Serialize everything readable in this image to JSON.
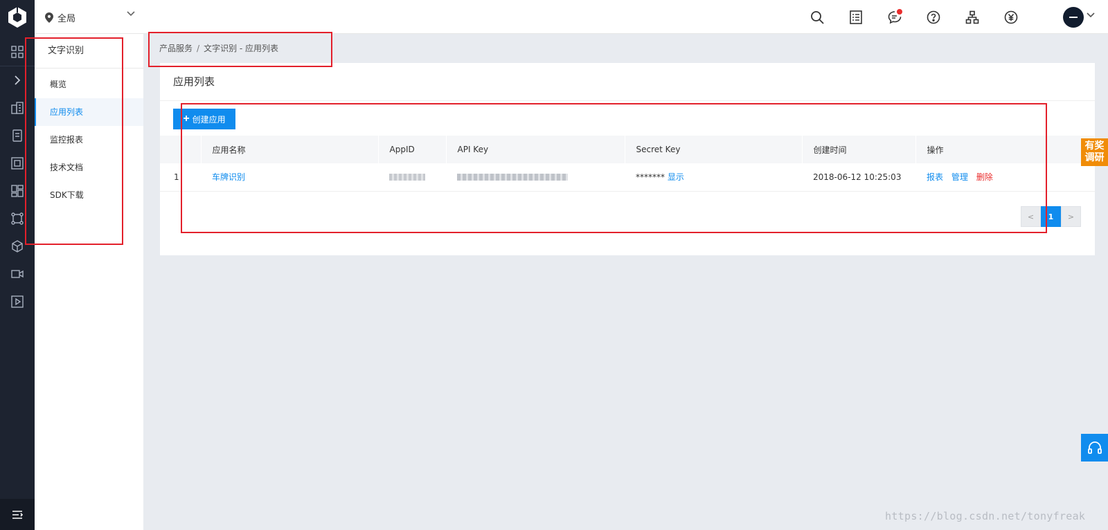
{
  "colors": {
    "accent": "#108cee",
    "danger": "#ea2e2e",
    "survey": "#f08c08",
    "rail": "#1d2330",
    "annotation": "#e3202b"
  },
  "header": {
    "region": "全局",
    "icons": [
      "search-icon",
      "orders-icon",
      "message-icon",
      "help-icon",
      "org-icon",
      "currency-icon"
    ]
  },
  "sidebar": {
    "title": "文字识别",
    "items": [
      {
        "label": "概览"
      },
      {
        "label": "应用列表",
        "active": true
      },
      {
        "label": "监控报表"
      },
      {
        "label": "技术文档"
      },
      {
        "label": "SDK下载"
      }
    ]
  },
  "breadcrumb": {
    "root": "产品服务",
    "separator": "/",
    "current": "文字识别 - 应用列表"
  },
  "panel": {
    "title": "应用列表",
    "create_label": "创建应用",
    "table": {
      "columns": [
        "",
        "应用名称",
        "AppID",
        "API Key",
        "Secret Key",
        "创建时间",
        "操作"
      ],
      "rows": [
        {
          "index": "1",
          "name": "车牌识别",
          "secret_mask": "*******",
          "show_label": "显示",
          "created": "2018-06-12 10:25:03",
          "actions": {
            "report": "报表",
            "manage": "管理",
            "delete": "删除"
          }
        }
      ]
    },
    "pagination": {
      "prev": "<",
      "current": "1",
      "next": ">"
    }
  },
  "widgets": {
    "survey_line1": "有奖",
    "survey_line2": "调研"
  },
  "watermark": "https://blog.csdn.net/tonyfreak"
}
